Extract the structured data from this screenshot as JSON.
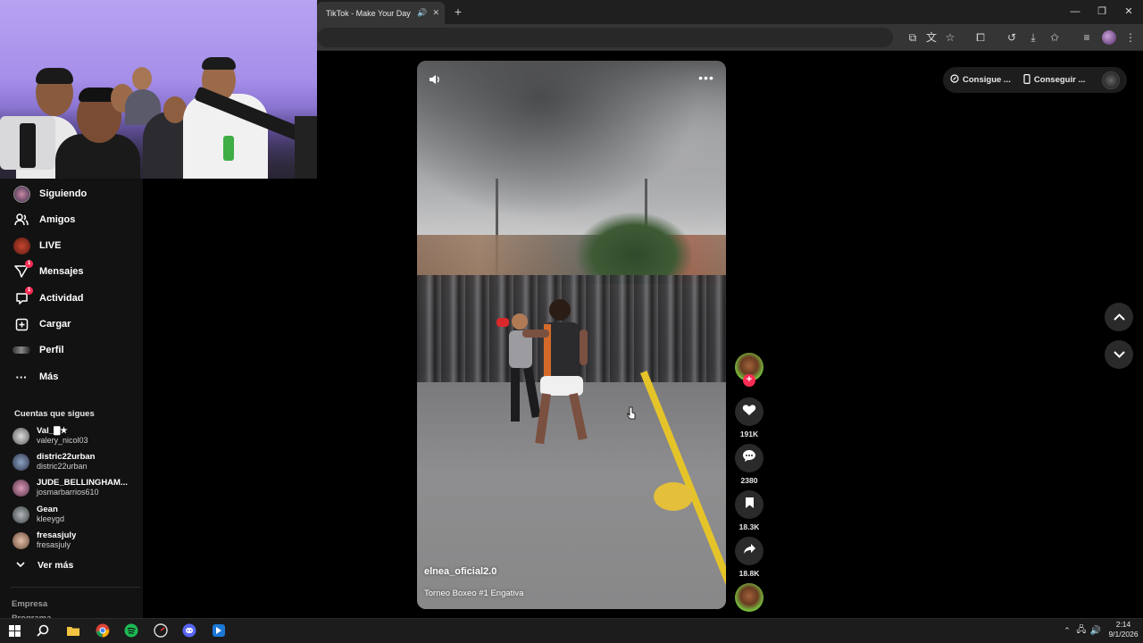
{
  "browser": {
    "tab_title": "TikTok - Make Your Day",
    "window_controls": [
      "minimize",
      "restore",
      "close"
    ]
  },
  "sidebar": {
    "nav": [
      {
        "label": "Siguiendo",
        "icon": "following-avatar-icon"
      },
      {
        "label": "Amigos",
        "icon": "friends-icon"
      },
      {
        "label": "LIVE",
        "icon": "live-icon"
      },
      {
        "label": "Mensajes",
        "icon": "messages-icon",
        "badge": "1"
      },
      {
        "label": "Actividad",
        "icon": "activity-icon",
        "badge": "1"
      },
      {
        "label": "Cargar",
        "icon": "upload-icon"
      },
      {
        "label": "Perfil",
        "icon": "profile-icon"
      },
      {
        "label": "Más",
        "icon": "more-icon"
      }
    ],
    "following_title": "Cuentas que sigues",
    "accounts": [
      {
        "name": "Val_🀫★",
        "handle": "valery_nicol03",
        "color": "#8d8d8d"
      },
      {
        "name": "distric22urban",
        "handle": "distric22urban",
        "color": "#4b5c78"
      },
      {
        "name": "JUDE_BELLINGHAM...",
        "handle": "josmarbarrios610",
        "color": "#9a6b8d"
      },
      {
        "name": "Gean",
        "handle": "kleeygd",
        "color": "#6b6f72"
      },
      {
        "name": "fresasjuly",
        "handle": "fresasjuly",
        "color": "#a58a7a"
      }
    ],
    "see_more": "Ver más",
    "footer_company": "Empresa",
    "footer_program": "Programa"
  },
  "video": {
    "username": "elnea_oficial2.0",
    "caption": "Torneo Boxeo #1 Engativa"
  },
  "actions": {
    "likes": "191K",
    "comments": "2380",
    "saves": "18.3K",
    "shares": "18.8K"
  },
  "top_right": {
    "get_coins": "Consigue ...",
    "get_app": "Conseguir ..."
  },
  "taskbar": {
    "time": "2:14",
    "date": "9/1/2026"
  },
  "colors": {
    "accent": "#fe2c55",
    "background": "#000000",
    "sidebar": "#121212"
  }
}
